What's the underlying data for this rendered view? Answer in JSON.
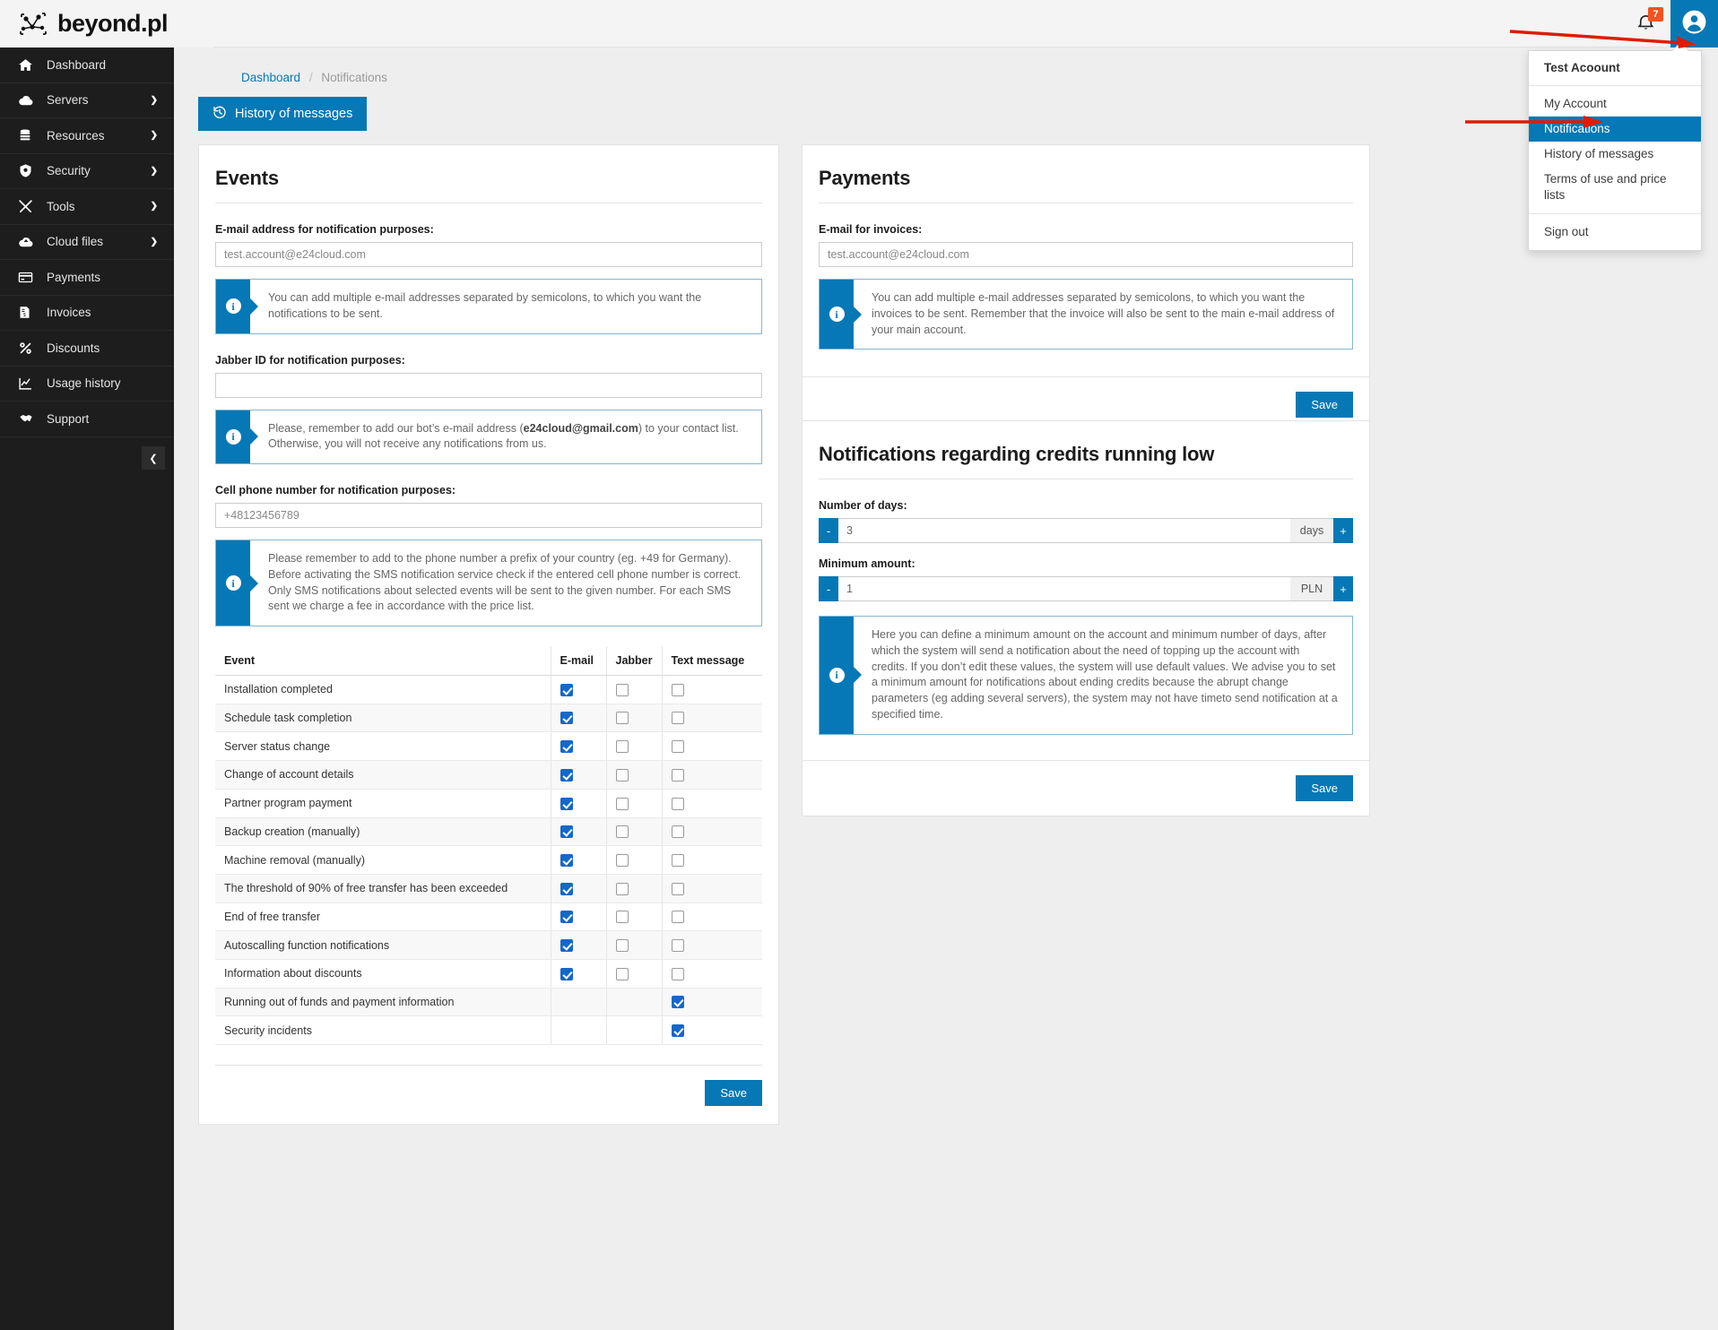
{
  "brand": {
    "name": "beyond.pl",
    "logo_icon": "network-nodes-logo"
  },
  "topbar": {
    "notification_count": "7",
    "bell_icon": "bell-icon",
    "avatar_icon": "user-avatar-icon",
    "accent_color": "#0678b5",
    "badge_color": "#f4511e"
  },
  "user_menu": {
    "account_name": "Test Acoount",
    "items": [
      {
        "label": "My Account",
        "active": false
      },
      {
        "label": "Notifications",
        "active": true
      },
      {
        "label": "History of messages",
        "active": false
      },
      {
        "label": "Terms of use and price lists",
        "active": false
      }
    ],
    "signout": "Sign out"
  },
  "sidebar": {
    "items": [
      {
        "label": "Dashboard",
        "icon": "home-icon",
        "chevron": false
      },
      {
        "label": "Servers",
        "icon": "cloud-icon",
        "chevron": true
      },
      {
        "label": "Resources",
        "icon": "database-icon",
        "chevron": true
      },
      {
        "label": "Security",
        "icon": "shield-icon",
        "chevron": true
      },
      {
        "label": "Tools",
        "icon": "tools-icon",
        "chevron": true
      },
      {
        "label": "Cloud files",
        "icon": "cloud-upload-icon",
        "chevron": true
      },
      {
        "label": "Payments",
        "icon": "credit-card-icon",
        "chevron": false
      },
      {
        "label": "Invoices",
        "icon": "invoice-icon",
        "chevron": false
      },
      {
        "label": "Discounts",
        "icon": "percent-icon",
        "chevron": false
      },
      {
        "label": "Usage history",
        "icon": "chart-line-icon",
        "chevron": false
      },
      {
        "label": "Support",
        "icon": "handshake-icon",
        "chevron": false
      }
    ],
    "collapse_icon": "chevron-left-icon"
  },
  "breadcrumb": {
    "root": "Dashboard",
    "separator": "/",
    "current": "Notifications"
  },
  "history_button": {
    "label": "History of messages",
    "icon": "history-icon"
  },
  "events_panel": {
    "title": "Events",
    "email_label": "E-mail address for notification purposes:",
    "email_value": "test.account@e24cloud.com",
    "email_alert": "You can add multiple e-mail addresses separated by semicolons, to which you want the notifications to be sent.",
    "jabber_label": "Jabber ID for notification purposes:",
    "jabber_value": "",
    "jabber_alert_pre": "Please, remember to add our bot’s e-mail address (",
    "jabber_alert_bold": "e24cloud@gmail.com",
    "jabber_alert_post": ") to your contact list. Otherwise, you will not receive any notifications from us.",
    "phone_label": "Cell phone number for notification purposes:",
    "phone_value": "+48123456789",
    "phone_alert": "Please remember to add to the phone number a prefix of your country (eg. +49 for Germany). Before activating the SMS notification service check if the entered cell phone number is correct. Only SMS notifications about selected events will be sent to the given number. For each SMS sent we charge a fee in accordance with the price list.",
    "table": {
      "headers": [
        "Event",
        "E-mail",
        "Jabber",
        "Text message"
      ],
      "rows": [
        {
          "event": "Installation completed",
          "email": "checked",
          "jabber": "unchecked",
          "sms": "unchecked"
        },
        {
          "event": "Schedule task completion",
          "email": "checked",
          "jabber": "unchecked",
          "sms": "unchecked"
        },
        {
          "event": "Server status change",
          "email": "checked",
          "jabber": "unchecked",
          "sms": "unchecked"
        },
        {
          "event": "Change of account details",
          "email": "checked",
          "jabber": "unchecked",
          "sms": "unchecked"
        },
        {
          "event": "Partner program payment",
          "email": "checked",
          "jabber": "unchecked",
          "sms": "unchecked"
        },
        {
          "event": "Backup creation (manually)",
          "email": "checked",
          "jabber": "unchecked",
          "sms": "unchecked"
        },
        {
          "event": "Machine removal (manually)",
          "email": "checked",
          "jabber": "unchecked",
          "sms": "unchecked"
        },
        {
          "event": "The threshold of 90% of free transfer has been exceeded",
          "email": "checked",
          "jabber": "unchecked",
          "sms": "unchecked"
        },
        {
          "event": "End of free transfer",
          "email": "checked",
          "jabber": "unchecked",
          "sms": "unchecked"
        },
        {
          "event": "Autoscalling function notifications",
          "email": "checked",
          "jabber": "unchecked",
          "sms": "unchecked"
        },
        {
          "event": "Information about discounts",
          "email": "checked",
          "jabber": "unchecked",
          "sms": "unchecked"
        },
        {
          "event": "Running out of funds and payment information",
          "email": "none",
          "jabber": "none",
          "sms": "checked"
        },
        {
          "event": "Security incidents",
          "email": "none",
          "jabber": "none",
          "sms": "checked"
        }
      ]
    },
    "save_label": "Save"
  },
  "payments_panel": {
    "title": "Payments",
    "email_label": "E-mail for invoices:",
    "email_value": "test.account@e24cloud.com",
    "alert": "You can add multiple e-mail addresses separated by semicolons, to which you want the invoices to be sent. Remember that the invoice will also be sent to the main e-mail address of your main account.",
    "save_label": "Save"
  },
  "credits_panel": {
    "title": "Notifications regarding credits running low",
    "days_label": "Number of days:",
    "days_value": "3",
    "days_unit": "days",
    "amount_label": "Minimum amount:",
    "amount_value": "1",
    "amount_unit": "PLN",
    "minus_label": "-",
    "plus_label": "+",
    "alert": "Here you can define a minimum amount on the account and minimum number of days, after which the system will send a notification about the need of topping up the account with credits. If you don’t edit these values, the system will use default values. We advise you to set a minimum amount for notifications about ending credits because the abrupt change parameters (eg adding several servers), the system may not have timeto send notification at a specified time.",
    "save_label": "Save"
  },
  "annotations": {
    "arrow_color": "#e01b00",
    "arrow_to_avatar": "points to user avatar button",
    "arrow_to_notifications": "points to Notifications menu item"
  }
}
